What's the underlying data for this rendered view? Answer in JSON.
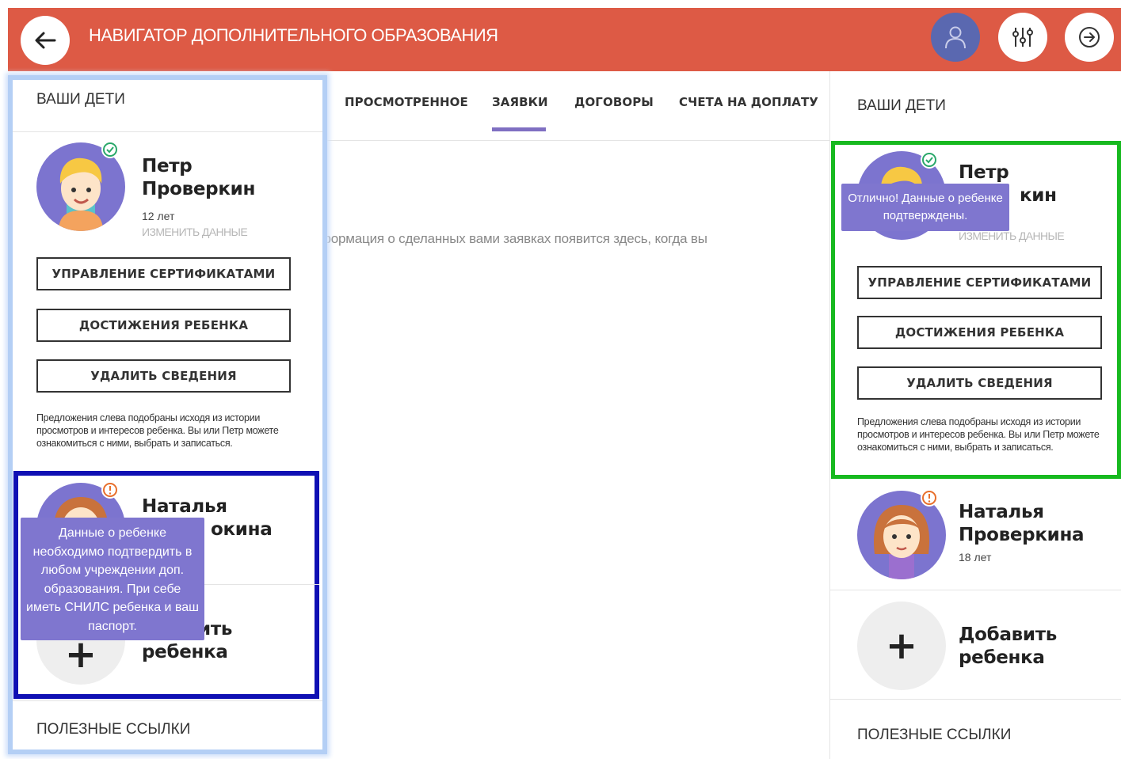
{
  "header": {
    "title": "НАВИГАТОР ДОПОЛНИТЕЛЬНОГО ОБРАЗОВАНИЯ",
    "accent_color": "#dd5a45"
  },
  "tabs": [
    {
      "label": "ПРОСМОТРЕННОЕ",
      "active": false
    },
    {
      "label": "ЗАЯВКИ",
      "active": true
    },
    {
      "label": "ДОГОВОРЫ",
      "active": false
    },
    {
      "label": "СЧЕТА НА ДОПЛАТУ",
      "active": false
    }
  ],
  "main": {
    "empty_text": "формация о сделанных вами заявках появится здесь, когда вы"
  },
  "left_panel": {
    "title": "ВАШИ ДЕТИ",
    "child1": {
      "name_line1": "Петр",
      "name_line2": "Проверкин",
      "age": "12 лет",
      "edit_label": "ИЗМЕНИТЬ ДАННЫЕ",
      "status": "verified"
    },
    "buttons": {
      "certificates": "УПРАВЛЕНИЕ СЕРТИФИКАТАМИ",
      "achievements": "ДОСТИЖЕНИЯ РЕБЕНКА",
      "delete": "УДАЛИТЬ СВЕДЕНИЯ"
    },
    "note": "Предложения слева подобраны исходя из истории просмотров и интересов ребенка. Вы или Петр можете ознакомиться с ними, выбрать и записаться.",
    "child2": {
      "name_line1": "Наталья",
      "name_line2_visible": "окина",
      "status": "warning"
    },
    "add_child": {
      "line1_visible": "ить",
      "line2": "ребенка"
    },
    "tooltip": "Данные о ребенке необходимо подтвердить в любом учреждении доп. образования. При себе иметь СНИЛС ребенка и ваш паспорт.",
    "useful_links": "ПОЛЕЗНЫЕ ССЫЛКИ"
  },
  "right_panel": {
    "title": "ВАШИ ДЕТИ",
    "child1": {
      "name_line1": "Петр",
      "name_line2_visible": "кин",
      "edit_label": "ИЗМЕНИТЬ ДАННЫЕ",
      "status": "verified"
    },
    "tooltip": "Отлично! Данные о ребенке подтверждены.",
    "buttons": {
      "certificates": "УПРАВЛЕНИЕ СЕРТИФИКАТАМИ",
      "achievements": "ДОСТИЖЕНИЯ РЕБЕНКА",
      "delete": "УДАЛИТЬ СВЕДЕНИЯ"
    },
    "note": "Предложения слева подобраны исходя из истории просмотров и интересов ребенка. Вы или Петр можете ознакомиться с ними, выбрать и записаться.",
    "child2": {
      "name_line1": "Наталья",
      "name_line2": "Проверкина",
      "age": "18 лет",
      "status": "warning"
    },
    "add_child": {
      "line1": "Добавить",
      "line2": "ребенка"
    },
    "useful_links": "ПОЛЕЗНЫЕ ССЫЛКИ"
  },
  "colors": {
    "avatar_bg": "#7c74cf",
    "tooltip_bg": "#7f76cf",
    "tab_active": "#7f6fc2",
    "highlight_blue": "#0f10b4",
    "highlight_green": "#17b91f",
    "verified": "#2aa86a",
    "warning": "#e86f2c"
  },
  "icons": [
    "back-arrow-icon",
    "user-icon",
    "filter-sliders-icon",
    "exit-icon",
    "check-icon",
    "warning-icon",
    "plus-icon"
  ]
}
